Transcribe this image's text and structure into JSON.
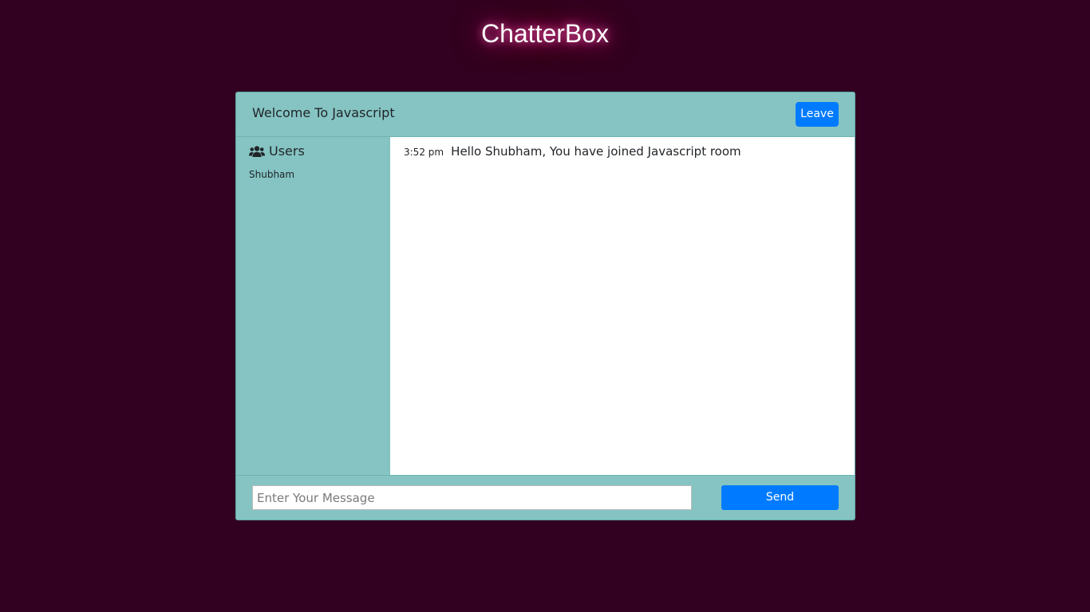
{
  "app": {
    "title": "ChatterBox"
  },
  "header": {
    "welcome_text": "Welcome To Javascript",
    "leave_label": "Leave"
  },
  "sidebar": {
    "heading_icon": "users-icon",
    "heading": "Users",
    "users": [
      "Shubham"
    ]
  },
  "messages": [
    {
      "time": "3:52 pm",
      "text": "Hello Shubham, You have joined Javascript room"
    }
  ],
  "composer": {
    "placeholder": "Enter Your Message",
    "value": "",
    "send_label": "Send"
  },
  "colors": {
    "page_background": "#320020",
    "card_background": "#85c4c3",
    "primary_button": "#007bff"
  }
}
